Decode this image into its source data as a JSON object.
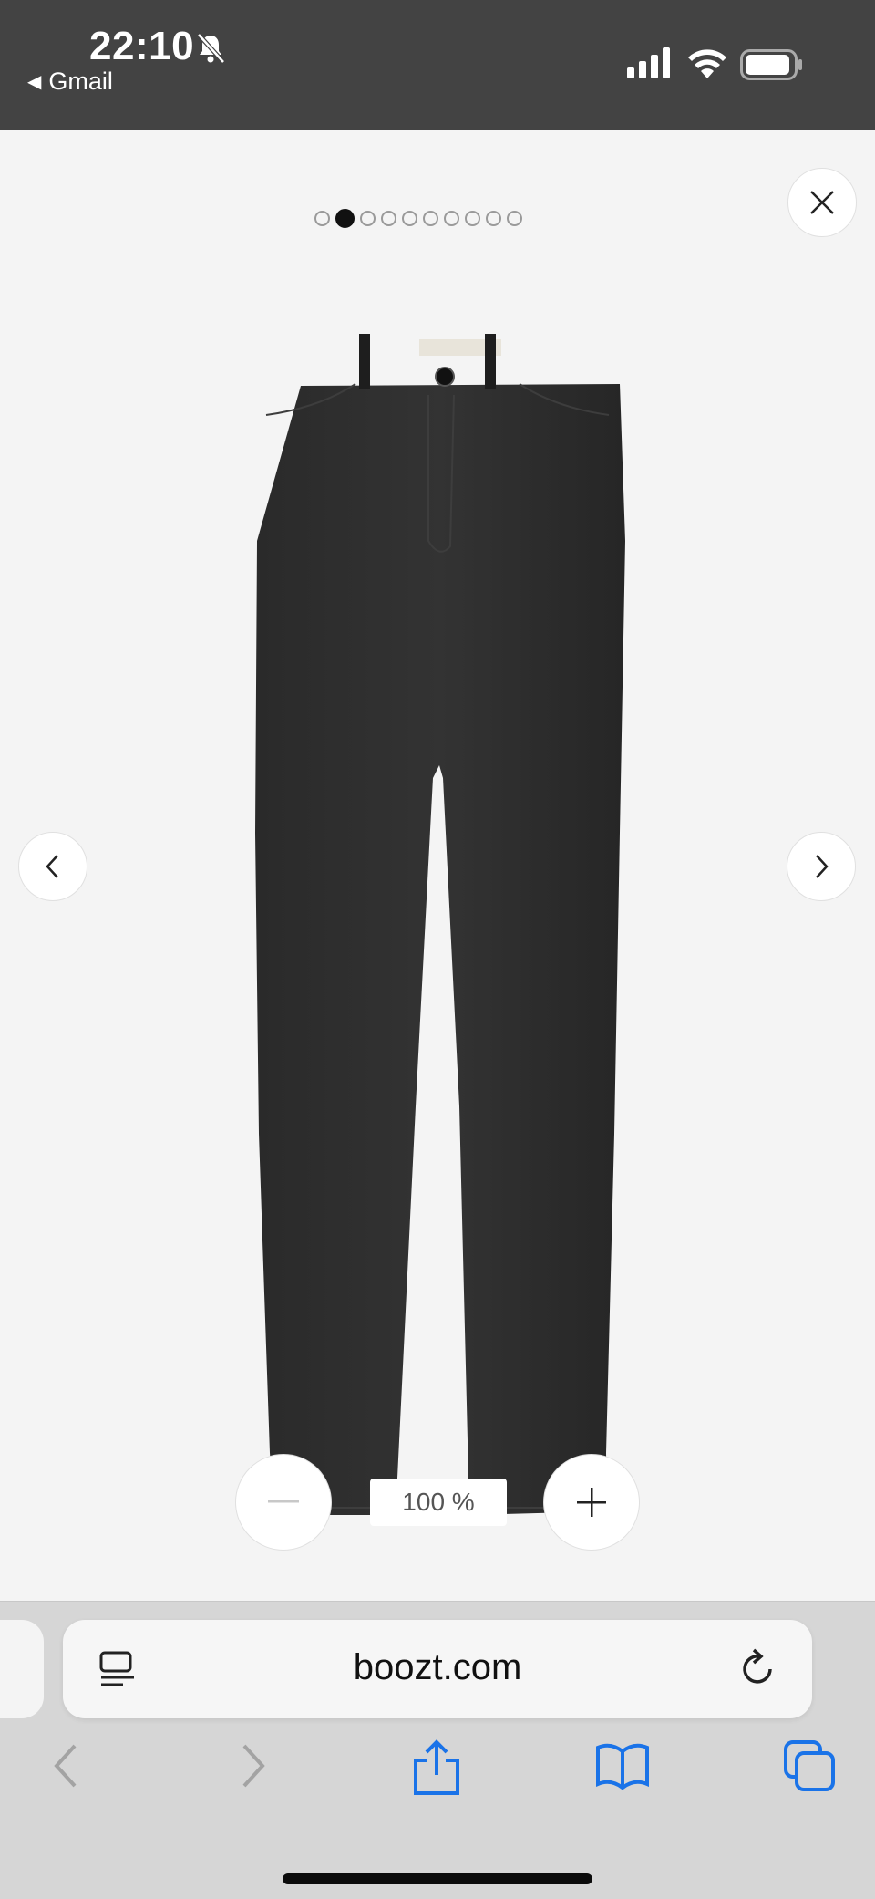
{
  "status_bar": {
    "time": "22:10",
    "back_app": "Gmail",
    "icons": [
      "bell-slash-icon",
      "signal-icon",
      "wifi-icon",
      "battery-icon"
    ]
  },
  "gallery": {
    "image_count": 10,
    "active_index": 1,
    "image_subject": "black high-waisted tapered denim jeans"
  },
  "zoom": {
    "level": "100 %"
  },
  "browser": {
    "url": "boozt.com",
    "accent_color": "#1a73e8"
  }
}
